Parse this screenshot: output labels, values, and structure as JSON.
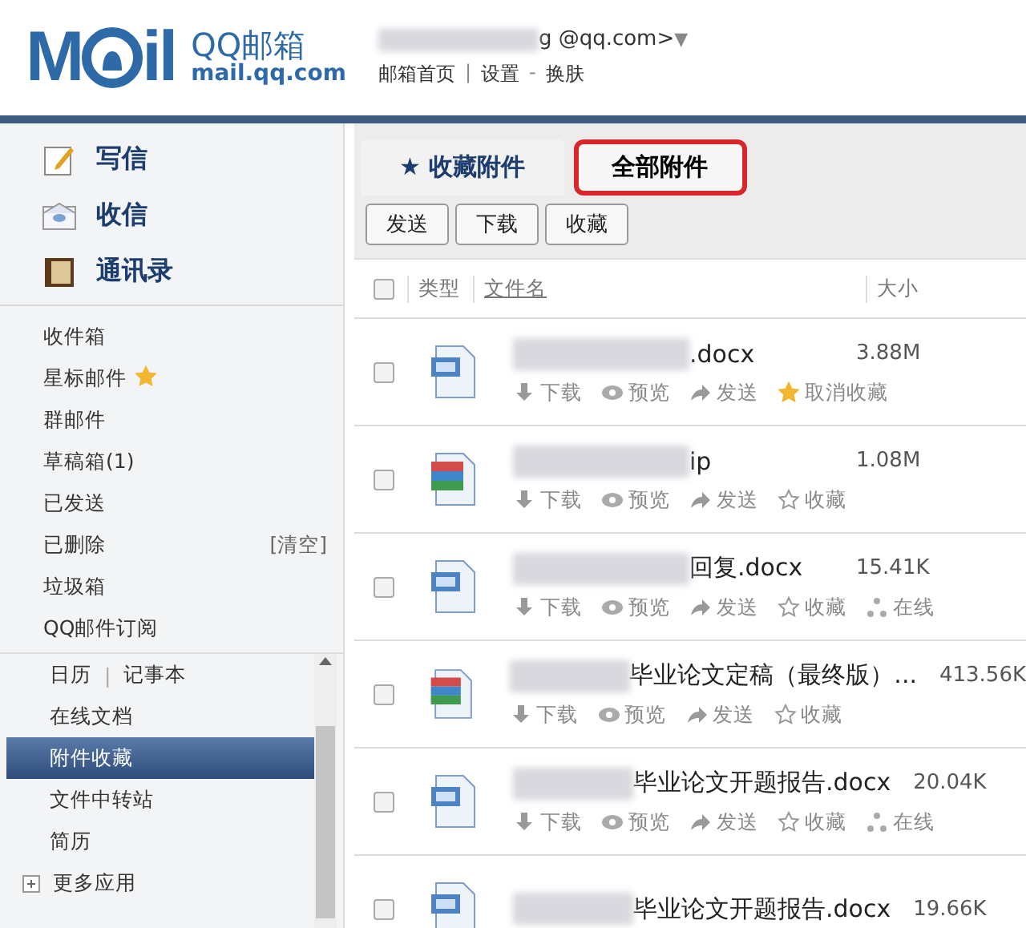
{
  "header": {
    "logo_word": "M",
    "logo_word_end": "il",
    "brand": "QQ邮箱",
    "domain": "mail.qq.com",
    "account": "g  @qq.com>",
    "account_caret": "▼",
    "links": [
      {
        "label": "邮箱首页",
        "kind": "link"
      },
      {
        "label": "|",
        "kind": "sep"
      },
      {
        "label": "设置",
        "kind": "link"
      },
      {
        "label": "-",
        "kind": "sep"
      },
      {
        "label": "换肤",
        "kind": "link"
      }
    ]
  },
  "sidebar": {
    "main_actions": [
      {
        "label": "写信",
        "kind": "write"
      },
      {
        "label": "收信",
        "kind": "receive"
      },
      {
        "label": "通讯录",
        "kind": "contacts"
      }
    ],
    "folders": [
      {
        "label": "收件箱",
        "starred": false
      },
      {
        "label": "星标邮件",
        "starred": true
      },
      {
        "label": "群邮件",
        "starred": false
      },
      {
        "label": "草稿箱(1)",
        "starred": false
      },
      {
        "label": "已发送",
        "starred": false
      },
      {
        "label": "已删除",
        "starred": false,
        "action": "[清空]"
      },
      {
        "label": "垃圾箱",
        "starred": false
      },
      {
        "label": "QQ邮件订阅",
        "starred": false
      }
    ],
    "apps": [
      {
        "label": "日历",
        "separator": "|",
        "extra": "记事本",
        "selected": false
      },
      {
        "label": "在线文档",
        "selected": false
      },
      {
        "label": "附件收藏",
        "selected": true
      },
      {
        "label": "文件中转站",
        "selected": false
      },
      {
        "label": "简历",
        "selected": false
      }
    ],
    "more": "更多应用"
  },
  "tabs": [
    {
      "icon": "★",
      "label": "收藏附件",
      "selected": false,
      "highlighted": false
    },
    {
      "label": "全部附件",
      "selected": true,
      "highlighted": true
    }
  ],
  "toolbar": [
    "发送",
    "下载",
    "收藏"
  ],
  "table": {
    "select_all_checked": false,
    "columns": [
      "类型",
      "文件名",
      "大小"
    ],
    "rows": [
      {
        "kind": "word",
        "checked": false,
        "name": ".docx",
        "size": "3.88M",
        "actions": [
          {
            "kind": "download",
            "label": "下载"
          },
          {
            "kind": "preview",
            "label": "预览"
          },
          {
            "kind": "send",
            "label": "发送"
          },
          {
            "kind": "favorite",
            "label": "取消收藏",
            "on": true
          }
        ]
      },
      {
        "kind": "archive",
        "checked": false,
        "name": "ip",
        "size": "1.08M",
        "actions": [
          {
            "kind": "download",
            "label": "下载"
          },
          {
            "kind": "preview",
            "label": "预览"
          },
          {
            "kind": "send",
            "label": "发送"
          },
          {
            "kind": "favorite",
            "label": "收藏",
            "on": false
          }
        ]
      },
      {
        "kind": "word",
        "checked": false,
        "name": "回复.docx",
        "size": "15.41K",
        "actions": [
          {
            "kind": "download",
            "label": "下载"
          },
          {
            "kind": "preview",
            "label": "预览"
          },
          {
            "kind": "send",
            "label": "发送"
          },
          {
            "kind": "favorite",
            "label": "收藏",
            "on": false
          },
          {
            "kind": "online",
            "label": "在线"
          }
        ]
      },
      {
        "kind": "archive",
        "checked": false,
        "name": "毕业论文定稿（最终版）...",
        "size": "413.56K",
        "actions": [
          {
            "kind": "download",
            "label": "下载"
          },
          {
            "kind": "preview",
            "label": "预览"
          },
          {
            "kind": "send",
            "label": "发送"
          },
          {
            "kind": "favorite",
            "label": "收藏",
            "on": false
          }
        ]
      },
      {
        "kind": "word",
        "checked": false,
        "name": "毕业论文开题报告.docx",
        "size": "20.04K",
        "actions": [
          {
            "kind": "download",
            "label": "下载"
          },
          {
            "kind": "preview",
            "label": "预览"
          },
          {
            "kind": "send",
            "label": "发送"
          },
          {
            "kind": "favorite",
            "label": "收藏",
            "on": false
          },
          {
            "kind": "online",
            "label": "在线"
          }
        ]
      },
      {
        "kind": "word",
        "checked": false,
        "name": "毕业论文开题报告.docx",
        "size": "19.66K",
        "actions": []
      }
    ]
  }
}
